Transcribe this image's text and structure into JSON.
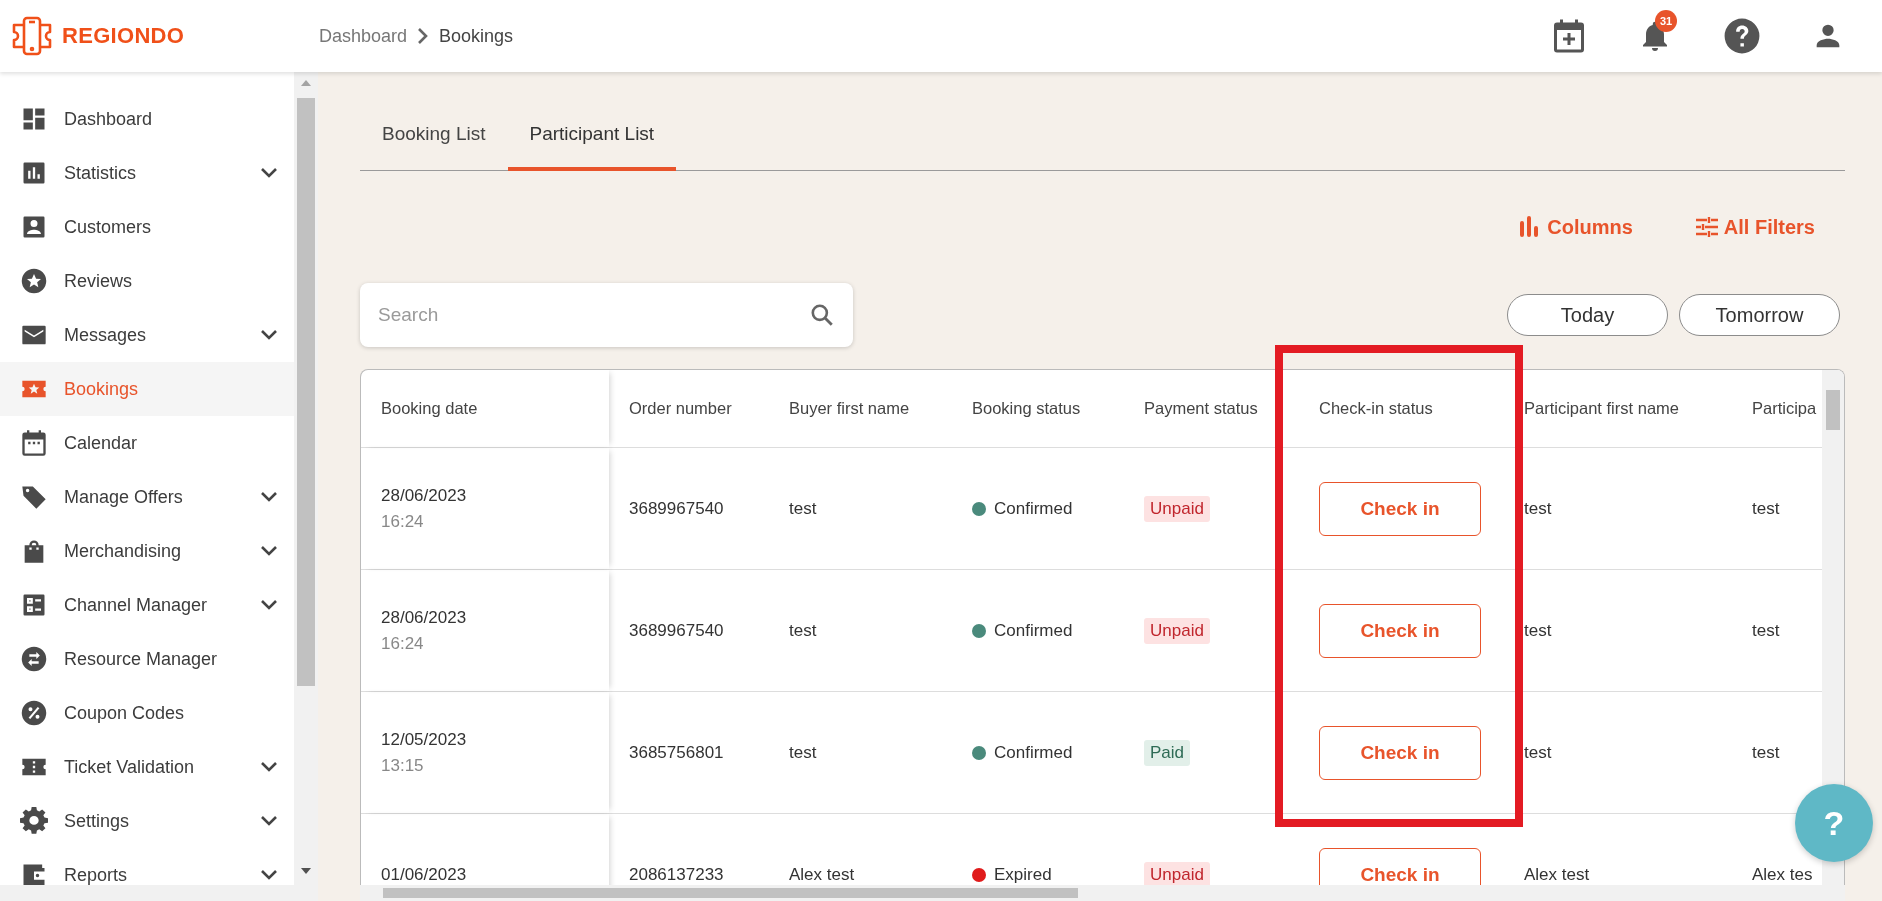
{
  "header": {
    "logo": "REGIONDO",
    "breadcrumb": [
      "Dashboard",
      "Bookings"
    ],
    "notification_count": "31"
  },
  "sidebar": {
    "items": [
      {
        "label": "Dashboard",
        "selected": false,
        "has_submenu": false
      },
      {
        "label": "Statistics",
        "selected": false,
        "has_submenu": true
      },
      {
        "label": "Customers",
        "selected": false,
        "has_submenu": false
      },
      {
        "label": "Reviews",
        "selected": false,
        "has_submenu": false
      },
      {
        "label": "Messages",
        "selected": false,
        "has_submenu": true
      },
      {
        "label": "Bookings",
        "selected": true,
        "has_submenu": false
      },
      {
        "label": "Calendar",
        "selected": false,
        "has_submenu": false
      },
      {
        "label": "Manage Offers",
        "selected": false,
        "has_submenu": true
      },
      {
        "label": "Merchandising",
        "selected": false,
        "has_submenu": true
      },
      {
        "label": "Channel Manager",
        "selected": false,
        "has_submenu": true
      },
      {
        "label": "Resource Manager",
        "selected": false,
        "has_submenu": false
      },
      {
        "label": "Coupon Codes",
        "selected": false,
        "has_submenu": false
      },
      {
        "label": "Ticket Validation",
        "selected": false,
        "has_submenu": true
      },
      {
        "label": "Settings",
        "selected": false,
        "has_submenu": true
      },
      {
        "label": "Reports",
        "selected": false,
        "has_submenu": true
      }
    ]
  },
  "tabs": [
    {
      "label": "Booking List",
      "selected": false
    },
    {
      "label": "Participant List",
      "selected": true
    }
  ],
  "toolbar": {
    "actions": [
      "Columns",
      "All Filters"
    ]
  },
  "search": {
    "placeholder": "Search"
  },
  "date_filters": [
    "Today",
    "Tomorrow"
  ],
  "table": {
    "columns": [
      "Booking date",
      "Order number",
      "Buyer first name",
      "Booking status",
      "Payment status",
      "Check-in status",
      "Participant first name",
      "Participa"
    ],
    "rows": [
      {
        "booking_date": "28/06/2023",
        "booking_time": "16:24",
        "order_number": "3689967540",
        "buyer_first_name": "test",
        "booking_status": {
          "label": "Confirmed",
          "color": "#4a8a7c"
        },
        "payment_status": {
          "label": "Unpaid",
          "paid": false
        },
        "check_in": "Check in",
        "participant_first_name": "test",
        "column_8": "test"
      },
      {
        "booking_date": "28/06/2023",
        "booking_time": "16:24",
        "order_number": "3689967540",
        "buyer_first_name": "test",
        "booking_status": {
          "label": "Confirmed",
          "color": "#4a8a7c"
        },
        "payment_status": {
          "label": "Unpaid",
          "paid": false
        },
        "check_in": "Check in",
        "participant_first_name": "test",
        "column_8": "test"
      },
      {
        "booking_date": "12/05/2023",
        "booking_time": "13:15",
        "order_number": "3685756801",
        "buyer_first_name": "test",
        "booking_status": {
          "label": "Confirmed",
          "color": "#4a8a7c"
        },
        "payment_status": {
          "label": "Paid",
          "paid": true
        },
        "check_in": "Check in",
        "participant_first_name": "test",
        "column_8": "test"
      },
      {
        "booking_date": "01/06/2023",
        "order_number": "2086137233",
        "buyer_first_name": "Alex test",
        "booking_status": {
          "label": "Expired",
          "color": "#e01b1b"
        },
        "payment_status": {
          "label": "Unpaid",
          "paid": false
        },
        "check_in": "Check in",
        "participant_first_name": "Alex test",
        "column_8": "Alex tes"
      }
    ]
  },
  "help_button": "?"
}
